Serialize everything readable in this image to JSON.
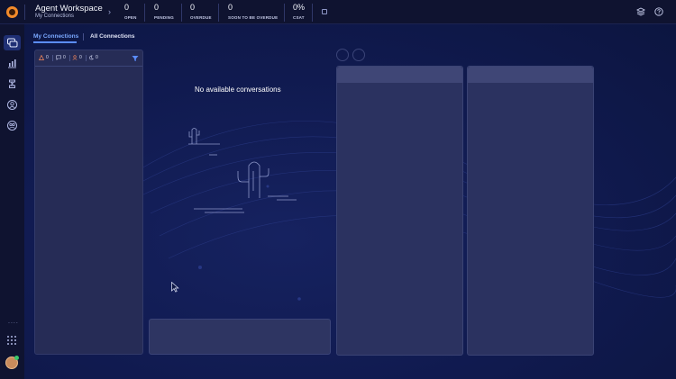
{
  "header": {
    "app_title": "Agent Workspace",
    "app_subtitle": "My Connections",
    "chevron": "›",
    "stats": [
      {
        "value": "0",
        "label": "OPEN"
      },
      {
        "value": "0",
        "label": "PENDING"
      },
      {
        "value": "0",
        "label": "OVERDUE"
      },
      {
        "value": "0",
        "label": "SOON TO BE OVERDUE"
      },
      {
        "value": "0%",
        "label": "CSAT"
      }
    ],
    "right_icons": [
      "layers-icon",
      "help-icon"
    ]
  },
  "sidebar": {
    "items": [
      {
        "icon": "conversations-icon",
        "active": true
      },
      {
        "icon": "analytics-icon",
        "active": false
      },
      {
        "icon": "agent-icon",
        "active": false
      },
      {
        "icon": "contacts-icon",
        "active": false
      },
      {
        "icon": "team-icon",
        "active": false
      }
    ],
    "more": "....",
    "apps_icon": "grid-icon",
    "avatar_status": "online"
  },
  "tabs": [
    {
      "label": "My Connections",
      "active": true
    },
    {
      "label": "All Connections",
      "active": false
    }
  ],
  "conversation_panel": {
    "counters": [
      {
        "icon": "alert-icon",
        "value": "0",
        "color": "#ff8c5a"
      },
      {
        "icon": "chat-icon",
        "value": "0",
        "color": "#c7cbe8"
      },
      {
        "icon": "waiting-icon",
        "value": "0",
        "color": "#ff8c5a"
      },
      {
        "icon": "moon-icon",
        "value": "0",
        "color": "#c7cbe8"
      }
    ],
    "filter_icon": "filter-icon"
  },
  "empty_state": {
    "message": "No available conversations",
    "illustration": "cactus-desert-icon"
  },
  "colors": {
    "accent": "#5b8dff",
    "brand_orange": "#f28a2a",
    "background": "#101a4f"
  }
}
